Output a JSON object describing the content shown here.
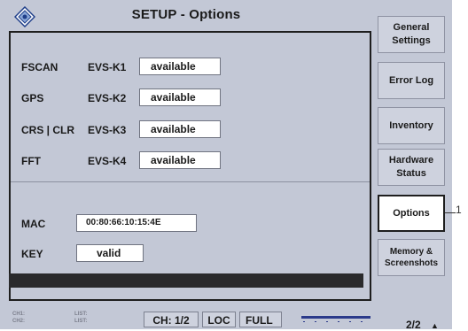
{
  "title": "SETUP - Options",
  "options": [
    {
      "label": "FSCAN",
      "code": "EVS-K1",
      "value": "available"
    },
    {
      "label": "GPS",
      "code": "EVS-K2",
      "value": "available"
    },
    {
      "label": "CRS | CLR",
      "code": "EVS-K3",
      "value": "available"
    },
    {
      "label": "FFT",
      "code": "EVS-K4",
      "value": "available"
    }
  ],
  "mac": {
    "label": "MAC",
    "value": "00:80:66:10:15:4E"
  },
  "key": {
    "label": "KEY",
    "value": "valid"
  },
  "status": {
    "ch_labels": [
      "CH1:",
      "CH2:"
    ],
    "list_labels": [
      "LIST:",
      "LIST:"
    ],
    "ch": "CH: 1/2",
    "loc": "LOC",
    "full": "FULL",
    "page": "2/2"
  },
  "menu": [
    {
      "line1": "General",
      "line2": "Settings"
    },
    {
      "line1": "Error Log",
      "line2": ""
    },
    {
      "line1": "Inventory",
      "line2": ""
    },
    {
      "line1": "Hardware",
      "line2": "Status"
    },
    {
      "line1": "Options",
      "line2": ""
    },
    {
      "line1": "Memory &",
      "line2": "Screenshots"
    }
  ],
  "callout": "1",
  "colors": {
    "background": "#c3c8d6",
    "field": "#ffffff",
    "border": "#1e1e1e",
    "meter": "#2b3a8a"
  }
}
